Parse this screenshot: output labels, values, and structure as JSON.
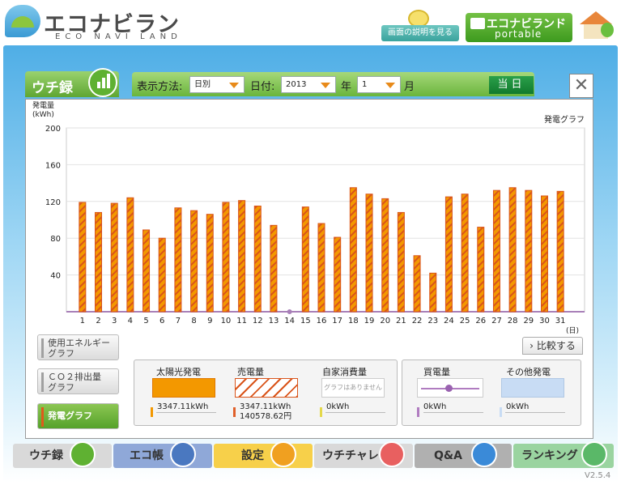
{
  "header": {
    "logo_title": "エコナビランド",
    "logo_sub": "ECO NAVI LAND",
    "help_label": "画面の説明を見る",
    "portable_title": "エコナビランド",
    "portable_sub": "portable"
  },
  "tab": {
    "label": "ウチ録"
  },
  "toolbar": {
    "method_label": "表示方法:",
    "method_value": "日別",
    "date_label": "日付:",
    "year_value": "2013",
    "year_label": "年",
    "month_value": "1",
    "month_label": "月",
    "today_label": "当日",
    "close_label": "✕"
  },
  "chart_head": {
    "y_title": "発電量",
    "y_unit": "(kWh)",
    "graph_name": "発電グラフ",
    "x_unit": "(日)"
  },
  "chart_data": {
    "type": "bar",
    "categories": [
      "1",
      "2",
      "3",
      "4",
      "5",
      "6",
      "7",
      "8",
      "9",
      "10",
      "11",
      "12",
      "13",
      "14",
      "15",
      "16",
      "17",
      "18",
      "19",
      "20",
      "21",
      "22",
      "23",
      "24",
      "25",
      "26",
      "27",
      "28",
      "29",
      "30",
      "31"
    ],
    "values": [
      119,
      108,
      118,
      124,
      89,
      80,
      113,
      110,
      106,
      119,
      121,
      115,
      94,
      0,
      114,
      96,
      81,
      135,
      128,
      123,
      108,
      61,
      42,
      125,
      128,
      92,
      132,
      135,
      132,
      126,
      131
    ],
    "yticks": [
      40,
      80,
      120,
      160,
      200
    ],
    "ylim": [
      0,
      200
    ],
    "bar_color": "#f39800",
    "stripe_color": "#d9541a",
    "zero_marker_color": "#a880b8",
    "grid": true
  },
  "side_buttons": [
    {
      "line1": "使用エネルギー",
      "line2": "グラフ"
    },
    {
      "line1": "ＣＯ２排出量",
      "line2": "グラフ"
    },
    {
      "line1": "発電グラフ"
    }
  ],
  "compare_label": "比較する",
  "legend": {
    "solar": {
      "label": "太陽光発電",
      "value": "3347.11kWh"
    },
    "sold": {
      "label": "売電量",
      "value": "3347.11kWh",
      "yen": "140578.62円"
    },
    "self": {
      "label": "自家消費量",
      "note": "グラフはありません",
      "value": "0kWh"
    },
    "bought": {
      "label": "買電量",
      "value": "0kWh"
    },
    "other": {
      "label": "その他発電",
      "value": "0kWh"
    }
  },
  "nav": [
    {
      "label": "ウチ録",
      "color": "#d9d9d9"
    },
    {
      "label": "エコ帳",
      "color": "#8fa8d8"
    },
    {
      "label": "設定",
      "color": "#f7d04a"
    },
    {
      "label": "ウチチャレ",
      "color": "#d9d9d9"
    },
    {
      "label": "Q&A",
      "color": "#b0b0b0"
    },
    {
      "label": "ランキング",
      "color": "#9ad4a0"
    }
  ],
  "version": "V2.5.4"
}
